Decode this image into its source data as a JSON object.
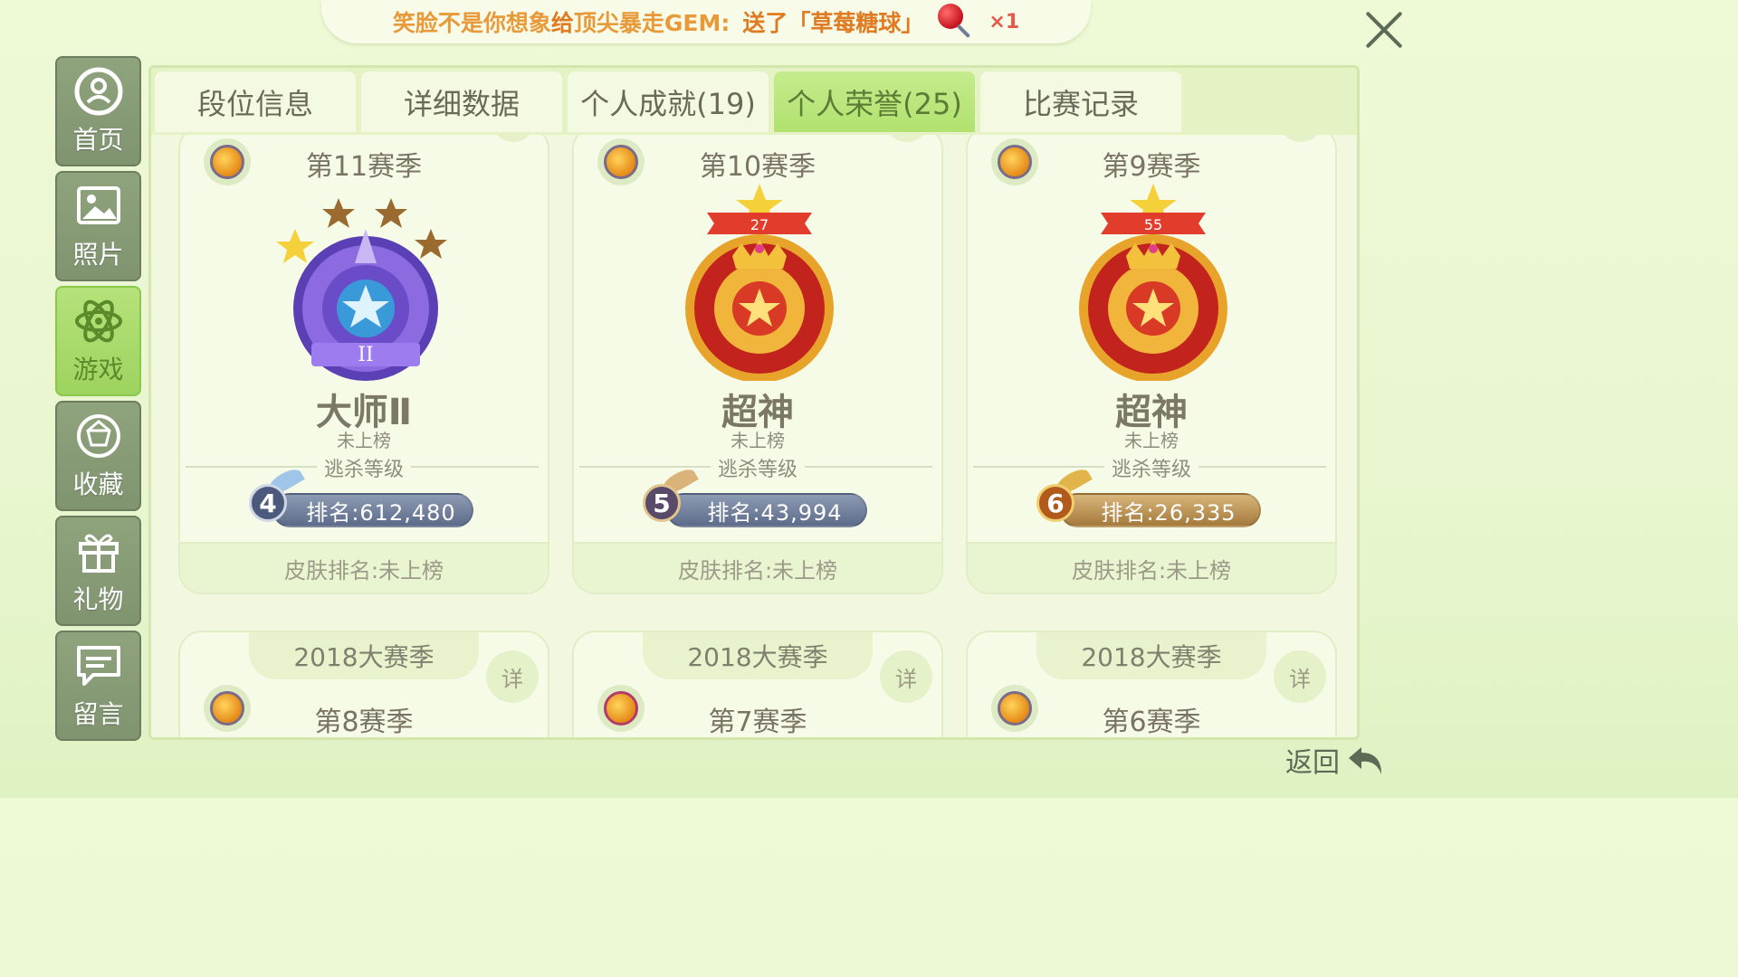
{
  "banner": {
    "text_prefix": "笑脸不是你想象",
    "text_mid": "给",
    "target": "顶尖暴走GEM:",
    "action": "送了「草莓糖球」",
    "count": "×1",
    "item_icon": "lollipop-icon"
  },
  "sidebar": {
    "items": [
      {
        "label": "首页",
        "icon": "home-user-icon"
      },
      {
        "label": "照片",
        "icon": "photo-icon"
      },
      {
        "label": "游戏",
        "icon": "atom-icon",
        "active": true
      },
      {
        "label": "收藏",
        "icon": "diamond-ring-icon"
      },
      {
        "label": "礼物",
        "icon": "gift-icon"
      },
      {
        "label": "留言",
        "icon": "chat-icon"
      }
    ]
  },
  "tabs": [
    {
      "label": "段位信息"
    },
    {
      "label": "详细数据"
    },
    {
      "label": "个人成就(19)"
    },
    {
      "label": "个人荣誉(25)",
      "active": true
    },
    {
      "label": "比赛记录"
    }
  ],
  "seasons": [
    {
      "title": "第11赛季",
      "rank_name": "大师Ⅱ",
      "status": "未上榜",
      "divider_label": "逃杀等级",
      "level": "4",
      "ranking": "排名:612,480",
      "skin_rank": "皮肤排名:未上榜",
      "badge_number": "",
      "badge_color": "#7b5bd6"
    },
    {
      "title": "第10赛季",
      "rank_name": "超神",
      "status": "未上榜",
      "divider_label": "逃杀等级",
      "level": "5",
      "ranking": "排名:43,994",
      "skin_rank": "皮肤排名:未上榜",
      "badge_number": "27",
      "badge_color": "#d7352a"
    },
    {
      "title": "第9赛季",
      "rank_name": "超神",
      "status": "未上榜",
      "divider_label": "逃杀等级",
      "level": "6",
      "ranking": "排名:26,335",
      "skin_rank": "皮肤排名:未上榜",
      "badge_number": "55",
      "badge_color": "#d7352a"
    }
  ],
  "lower_cards": [
    {
      "header": "2018大赛季",
      "title": "第8赛季",
      "detail": "详"
    },
    {
      "header": "2018大赛季",
      "title": "第7赛季",
      "detail": "详"
    },
    {
      "header": "2018大赛季",
      "title": "第6赛季",
      "detail": "详"
    }
  ],
  "back_label": "返回"
}
